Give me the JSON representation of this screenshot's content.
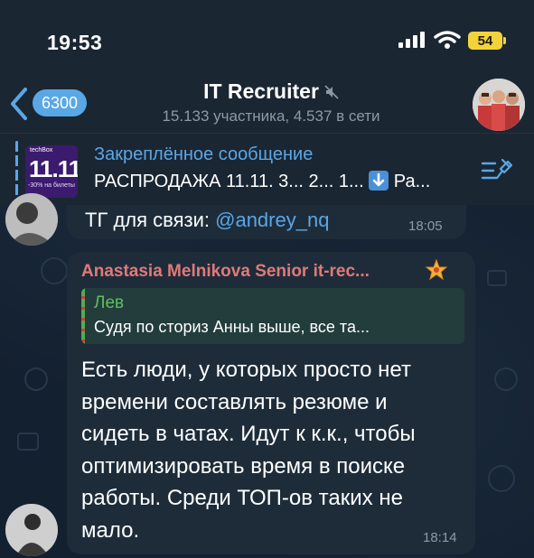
{
  "status_bar": {
    "time": "19:53",
    "battery": "54"
  },
  "header": {
    "back_count": "6300",
    "title": "IT Recruiter",
    "subtitle": "15.133 участника, 4.537 в сети"
  },
  "pinned": {
    "title": "Закреплённое сообщение",
    "text_before_emoji": "РАСПРОДАЖА 11.11. 3... 2... 1...",
    "text_after_emoji": "Ра...",
    "thumb_top": "techBox",
    "thumb_big": "11.11",
    "thumb_bottom": "-30% на билеты"
  },
  "messages": [
    {
      "text_prefix": "ТГ для связи: ",
      "mention": "@andrey_nq",
      "time": "18:05"
    },
    {
      "sender": "Anastasia Melnikova Senior it-rec...",
      "reply_name": "Лев",
      "reply_text": "Судя по сториз Анны выше, все та...",
      "body": "Есть люди, у которых просто нет времени составлять резюме и сидеть в чатах. Идут к к.к., чтобы оптимизировать время в поиске работы. Среди ТОП-ов таких не мало.",
      "time": "18:14"
    }
  ],
  "colors": {
    "accent": "#5aa7e6",
    "sender_name": "#e07a79",
    "reply_name": "#5fc05e",
    "bubble": "#1e2c3a",
    "header_bg": "#1b2633"
  },
  "icons": {
    "back": "chevron-left-icon",
    "mute": "muted-speaker-icon",
    "signal": "cellular-signal-icon",
    "wifi": "wifi-icon",
    "pin_list": "pinned-list-icon",
    "star": "star-emoji-icon",
    "arrow": "arrow-down-emoji-icon"
  }
}
